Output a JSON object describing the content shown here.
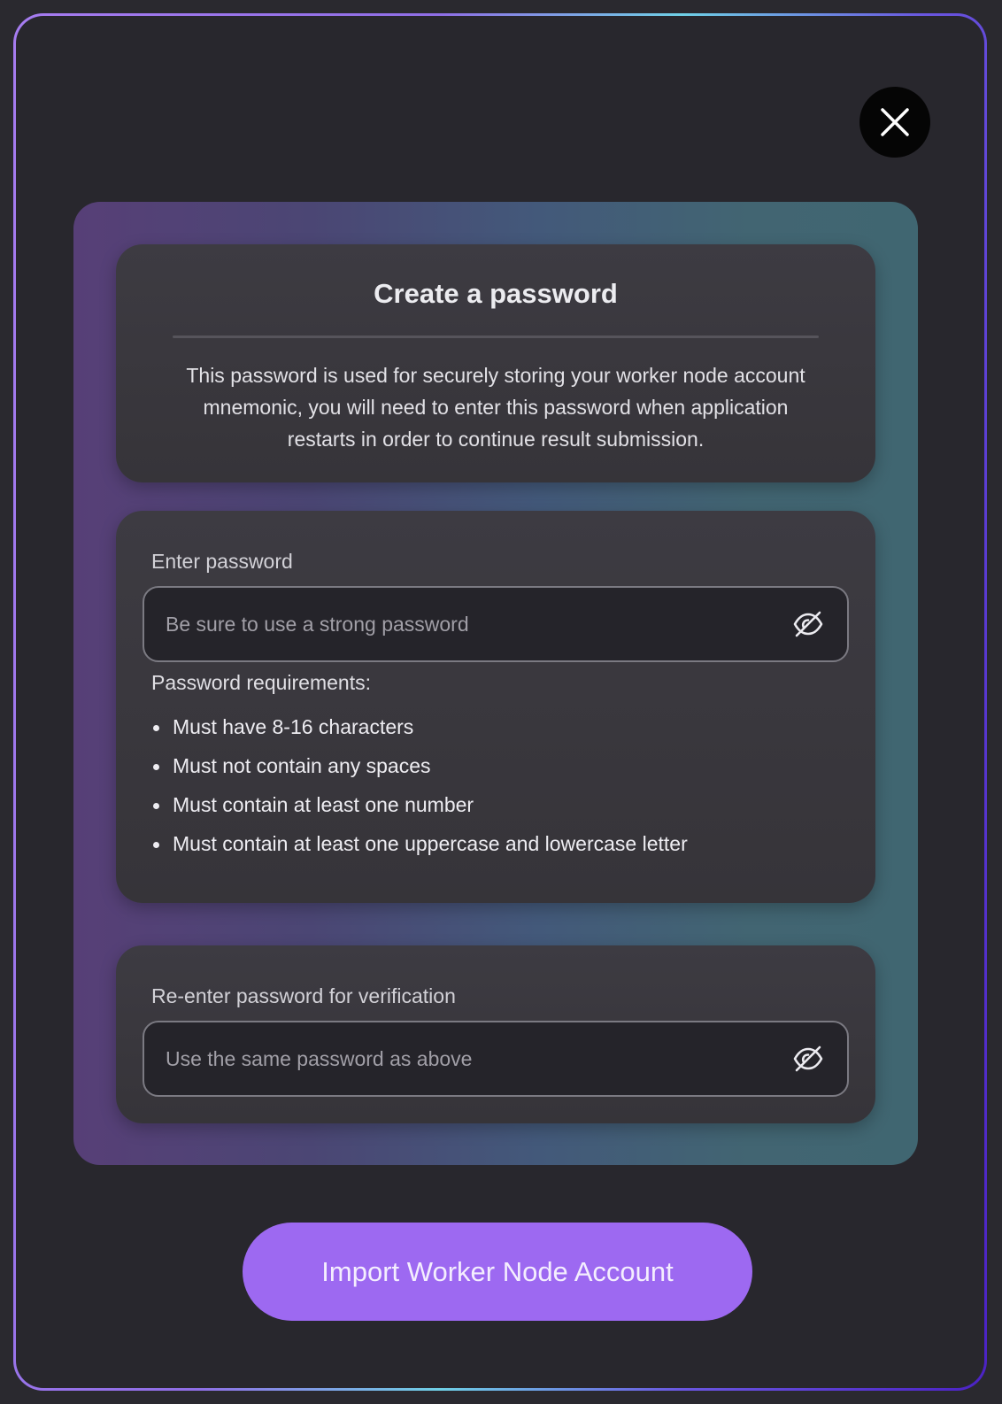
{
  "intro": {
    "title": "Create a password",
    "description": "This password is used for securely storing your worker node account mnemonic, you will need to enter this password when application restarts in order to continue result submission."
  },
  "password": {
    "label": "Enter password",
    "placeholder": "Be sure to use a strong password",
    "value": "",
    "requirements_title": "Password requirements:",
    "requirements": [
      "Must have 8-16 characters",
      "Must not contain any spaces",
      "Must contain at least one number",
      "Must contain at least one uppercase and lowercase letter"
    ]
  },
  "verify": {
    "label": "Re-enter password for verification",
    "placeholder": "Use the same password as above",
    "value": ""
  },
  "actions": {
    "import_label": "Import Worker Node Account"
  },
  "icons": {
    "close": "close-icon",
    "visibility": "eye-off-icon"
  },
  "colors": {
    "accent": "#9d69f1",
    "modal_background": "#28272d",
    "card_background": "#3a383f"
  }
}
